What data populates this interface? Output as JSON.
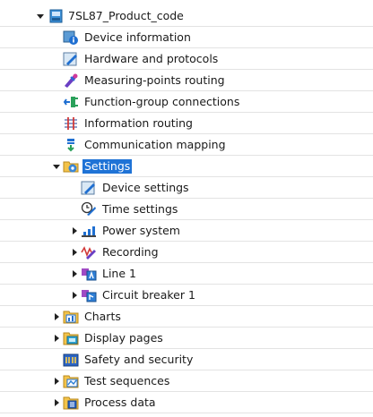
{
  "tree": {
    "root": "7SL87_Product_code",
    "items": [
      {
        "label": "Device information"
      },
      {
        "label": "Hardware and protocols"
      },
      {
        "label": "Measuring-points routing"
      },
      {
        "label": "Function-group connections"
      },
      {
        "label": "Information routing"
      },
      {
        "label": "Communication mapping"
      },
      {
        "label": "Settings",
        "selected": true
      },
      {
        "label": "Device settings"
      },
      {
        "label": "Time settings"
      },
      {
        "label": "Power system"
      },
      {
        "label": "Recording"
      },
      {
        "label": "Line 1"
      },
      {
        "label": "Circuit breaker 1"
      },
      {
        "label": "Charts"
      },
      {
        "label": "Display pages"
      },
      {
        "label": "Safety and security"
      },
      {
        "label": "Test sequences"
      },
      {
        "label": "Process data"
      }
    ]
  },
  "colors": {
    "selection": "#1f73d6",
    "row_divider": "#e3e3e3"
  }
}
